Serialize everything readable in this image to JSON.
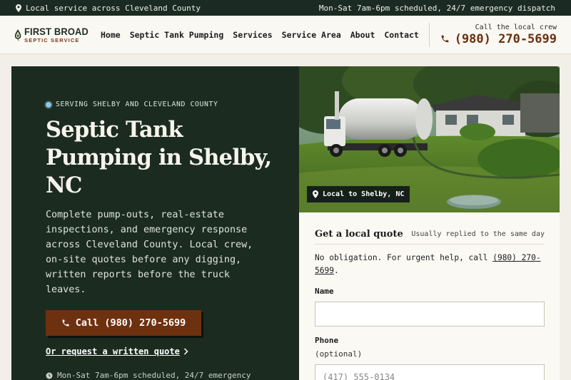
{
  "topbar": {
    "left_text": "Local service across Cleveland County",
    "right_text": "Mon-Sat 7am-6pm scheduled, 24/7 emergency dispatch"
  },
  "brand": {
    "name": "FIRST BROAD",
    "sub": "SEPTIC SERVICE",
    "colors": {
      "dark_green": "#1b2b1f",
      "rust": "#6e310f"
    }
  },
  "nav": {
    "items": [
      "Home",
      "Septic Tank Pumping",
      "Services",
      "Service Area",
      "About",
      "Contact"
    ]
  },
  "header_call": {
    "label": "Call the local crew",
    "phone": "(980) 270-5699"
  },
  "hero": {
    "kicker": "SERVING SHELBY AND CLEVELAND COUNTY",
    "title": "Septic Tank Pumping in Shelby, NC",
    "lead": "Complete pump-outs, real-estate inspections, and emergency response across Cleveland County. Local crew, on-site quotes before any digging, written reports before the truck leaves.",
    "cta_label": "Call (980) 270-5699",
    "secondary_link": "Or request a written quote",
    "hours": "Mon-Sat 7am-6pm scheduled, 24/7 emergency"
  },
  "photo": {
    "badge": "Local to Shelby, NC"
  },
  "quote_form": {
    "title": "Get a local quote",
    "note": "Usually replied to the same day",
    "sub_prefix": "No obligation. For urgent help, call ",
    "sub_phone": "(980) 270-5699",
    "sub_suffix": ".",
    "name_label": "Name",
    "phone_label": "Phone",
    "phone_optional": "(optional)",
    "phone_placeholder": "(417) 555-0134"
  },
  "icons": [
    "pin-icon",
    "phone-icon",
    "chevron-right-icon",
    "clock-icon",
    "logo-drop-icon"
  ]
}
